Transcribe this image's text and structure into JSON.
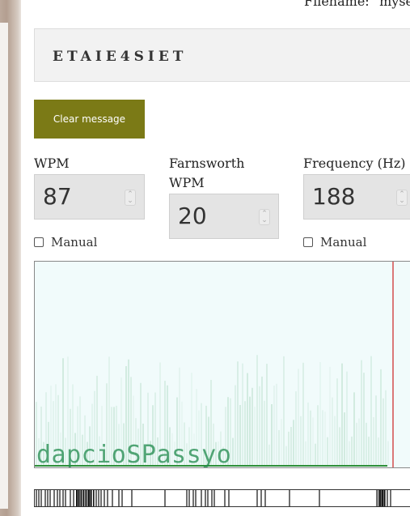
{
  "header": {
    "filename_text": "Filename: \"myse"
  },
  "message": {
    "text": "ETAIE4SIET"
  },
  "clear_button": {
    "label": "Clear message"
  },
  "fields": {
    "wpm": {
      "label": "WPM",
      "value": "87"
    },
    "farnsworth": {
      "label_line1": "Farnsworth",
      "label_line2": "WPM",
      "value": "20"
    },
    "frequency": {
      "label": "Frequency (Hz)",
      "value": "188"
    }
  },
  "manual": {
    "label": "Manual",
    "wpm_checked": false,
    "frequency_checked": false
  },
  "spectrogram": {
    "overlay_text": "dapcioSPassyo",
    "text_color": "#1f8a4c",
    "background": "#f1fbfb",
    "marker_color": "#cc2222"
  },
  "colors": {
    "button_bg": "#7b7a16",
    "button_text": "#ffffff",
    "input_bg": "#e4e4e4"
  },
  "icons": {
    "spinner": "spinner-arrows-icon",
    "checkbox": "checkbox-icon"
  }
}
